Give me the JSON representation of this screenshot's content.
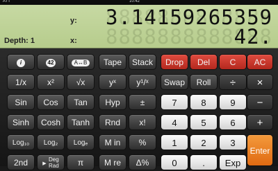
{
  "statusbar": {
    "left": "ATT",
    "center": "10:42"
  },
  "display": {
    "depth_label": "Depth: 1",
    "y_label": "y:",
    "x_label": "x:",
    "y_value": "3.14159265359",
    "x_value": "42.",
    "ghost_digits": "8888888888888"
  },
  "keys": {
    "info": "i",
    "badge42": "42",
    "swap_ab": "A↔B",
    "tape": "Tape",
    "stack": "Stack",
    "drop": "Drop",
    "del": "Del",
    "c": "C",
    "ac": "AC",
    "inv": "1/x",
    "sq": "x²",
    "sqrt": "√x",
    "yx": "yˣ",
    "yroot": "y¹/ˣ",
    "swap": "Swap",
    "roll": "Roll",
    "div": "÷",
    "mul": "×",
    "sin": "Sin",
    "cos": "Cos",
    "tan": "Tan",
    "hyp": "Hyp",
    "pm": "±",
    "n7": "7",
    "n8": "8",
    "n9": "9",
    "minus": "−",
    "sinh": "Sinh",
    "cosh": "Cosh",
    "tanh": "Tanh",
    "rnd": "Rnd",
    "fact": "x!",
    "n4": "4",
    "n5": "5",
    "n6": "6",
    "plus": "+",
    "log10": "Log₁₀",
    "log2": "Log₂",
    "loge": "Logₑ",
    "min": "M in",
    "pct": "%",
    "n1": "1",
    "n2": "2",
    "n3": "3",
    "enter": "Enter",
    "second": "2nd",
    "degrad_top": "Deg",
    "degrad_bot": "Rad",
    "pi": "π",
    "mre": "M re",
    "dpct": "Δ%",
    "n0": "0",
    "dot": ".",
    "exp": "Exp"
  }
}
